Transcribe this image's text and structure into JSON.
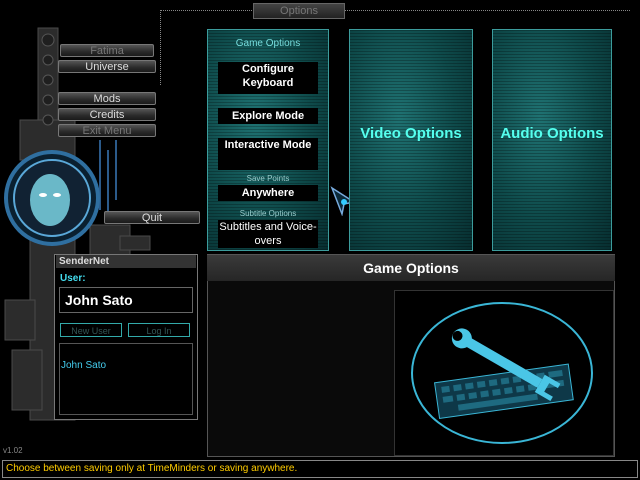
{
  "top_tab": "Options",
  "left_menu": {
    "fatima": "Fatima",
    "universe": "Universe",
    "mods": "Mods",
    "credits": "Credits",
    "exit": "Exit Menu",
    "quit": "Quit"
  },
  "game_options": {
    "heading": "Game Options",
    "configure_keyboard": "Configure Keyboard",
    "explore_mode": "Explore Mode",
    "interactive_mode": "Interactive Mode",
    "save_points_label": "Save Points",
    "save_points_value": "Anywhere",
    "subtitle_label": "Subtitle Options",
    "subtitle_value": "Subtitles and Voice-overs"
  },
  "video_panel": "Video Options",
  "audio_panel": "Audio Options",
  "preview": {
    "title": "Game Options"
  },
  "sendernet": {
    "title": "SenderNet",
    "user_label": "User:",
    "user_value": "John Sato",
    "new_user": "New User",
    "log_in": "Log In",
    "users": [
      "John Sato"
    ]
  },
  "version": "v1.02",
  "status_text": "Choose between saving only at TimeMinders or saving anywhere.",
  "colors": {
    "accent": "#55eeee",
    "status": "#ffcc00"
  }
}
